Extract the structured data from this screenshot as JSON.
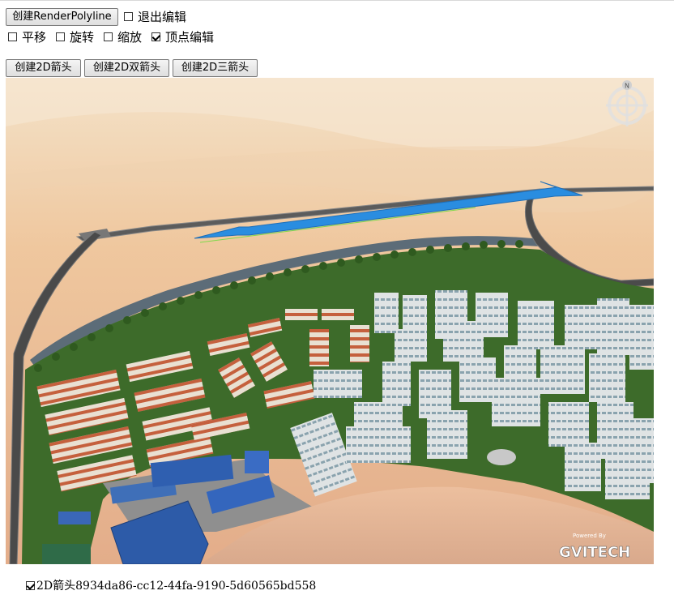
{
  "toolbar": {
    "create_polyline_label": "创建RenderPolyline",
    "exit_edit_label": "退出编辑",
    "exit_edit_checked": false
  },
  "modes": [
    {
      "label": "平移",
      "checked": false
    },
    {
      "label": "旋转",
      "checked": false
    },
    {
      "label": "缩放",
      "checked": false
    },
    {
      "label": "顶点编辑",
      "checked": true
    }
  ],
  "arrow_buttons": {
    "arrow_2d": "创建2D箭头",
    "double_arrow_2d": "创建2D双箭头",
    "triple_arrow_2d": "创建2D三箭头"
  },
  "viewport": {
    "watermark_small": "Powered By",
    "watermark_brand": "GVITECH",
    "compass_label": "N"
  },
  "objects": [
    {
      "label": "2D箭头8934da86-cc12-44fa-9190-5d60565bd558",
      "checked": true
    }
  ],
  "colors": {
    "arrow": "#2a8de0",
    "sky": "#e8b998",
    "grass": "#3d6b2a",
    "water": "#5a6a7a"
  }
}
